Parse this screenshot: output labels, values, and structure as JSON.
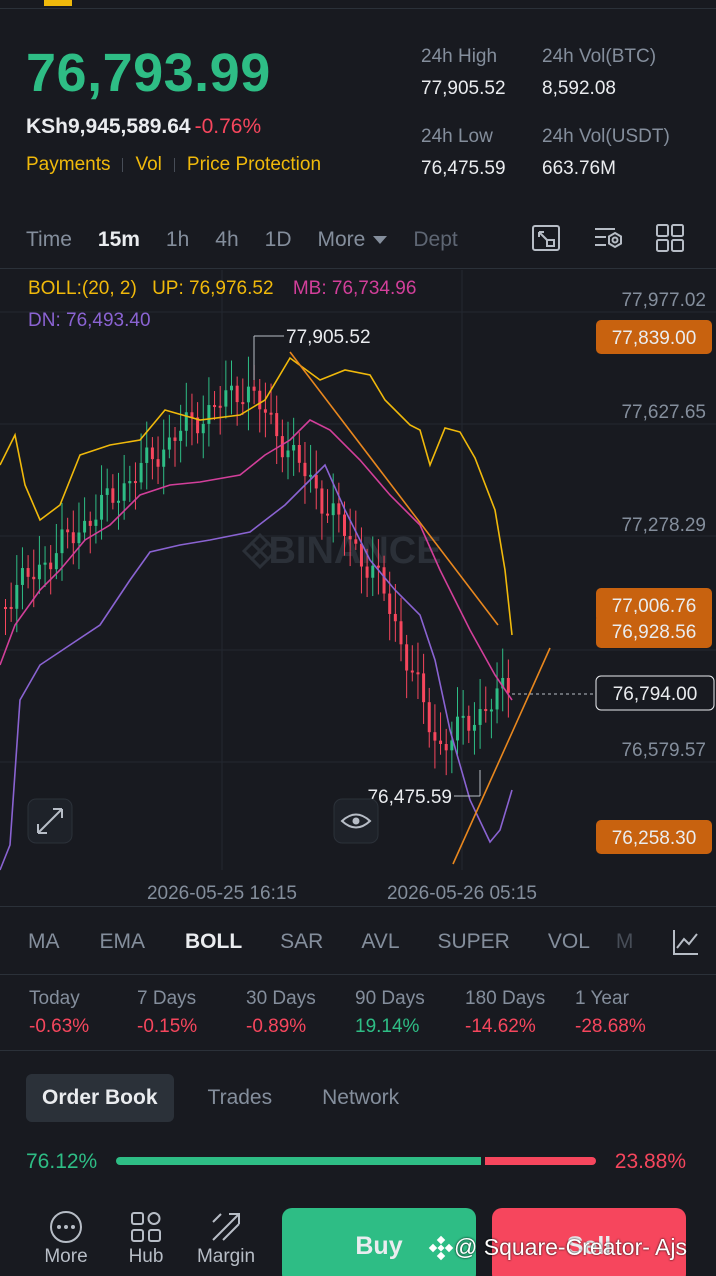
{
  "header": {
    "price": "76,793.99",
    "fiat_price": "KSh9,945,589.64",
    "change_pct": "-0.76%",
    "links": [
      "Payments",
      "Vol",
      "Price Protection"
    ]
  },
  "stats": {
    "high_label": "24h High",
    "high_value": "77,905.52",
    "vol_btc_label": "24h Vol(BTC)",
    "vol_btc_value": "8,592.08",
    "low_label": "24h Low",
    "low_value": "76,475.59",
    "vol_usdt_label": "24h Vol(USDT)",
    "vol_usdt_value": "663.76M"
  },
  "timeframes": {
    "items": [
      "Time",
      "15m",
      "1h",
      "4h",
      "1D"
    ],
    "active": "15m",
    "more_label": "More",
    "depth_label": "Dept"
  },
  "toolbar_icons": [
    "fullscreen-icon",
    "chart-settings-icon",
    "layout-grid-icon"
  ],
  "boll": {
    "label": "BOLL:(20, 2)",
    "up": "UP: 76,976.52",
    "mb": "MB: 76,734.96",
    "dn": "DN: 76,493.40"
  },
  "chart_data": {
    "type": "candlestick",
    "price_axis": [
      "77,977.02",
      "77,627.65",
      "77,278.29",
      "76,579.57"
    ],
    "price_tags": [
      {
        "value": "77,839.00",
        "color": "#c8620f"
      },
      {
        "value": "77,006.76",
        "color": "#c8620f"
      },
      {
        "value": "76,928.56",
        "color": "#c8620f"
      },
      {
        "value": "76,258.30",
        "color": "#c8620f"
      }
    ],
    "current_price_tag": "76,794.00",
    "high_annotation": "77,905.52",
    "low_annotation": "76,475.59",
    "time_axis": [
      "2026-05-25 16:15",
      "2026-05-26 05:15"
    ],
    "watermark": "BINANCE",
    "colors": {
      "up": "#2ebd85",
      "down": "#f6465d",
      "upper": "#f0b90b",
      "middle": "#d23f9a",
      "lower": "#8a63d2",
      "trendline": "#e8871e"
    }
  },
  "indicators": {
    "items": [
      "MA",
      "EMA",
      "BOLL",
      "SAR",
      "AVL",
      "SUPER",
      "VOL",
      "M"
    ],
    "active": "BOLL"
  },
  "performance": [
    {
      "label": "Today",
      "value": "-0.63%",
      "sign": "neg"
    },
    {
      "label": "7 Days",
      "value": "-0.15%",
      "sign": "neg"
    },
    {
      "label": "30 Days",
      "value": "-0.89%",
      "sign": "neg"
    },
    {
      "label": "90 Days",
      "value": "19.14%",
      "sign": "pos"
    },
    {
      "label": "180 Days",
      "value": "-14.62%",
      "sign": "neg"
    },
    {
      "label": "1 Year",
      "value": "-28.68%",
      "sign": "neg"
    }
  ],
  "orderbook": {
    "tabs": [
      "Order Book",
      "Trades",
      "Network"
    ],
    "active": "Order Book",
    "buy_ratio": "76.12%",
    "sell_ratio": "23.88%",
    "buy_fraction": 0.7612
  },
  "bottom_nav": {
    "items": [
      "More",
      "Hub",
      "Margin"
    ],
    "buy_label": "Buy",
    "sell_label": "Sell"
  },
  "watermark_bottom": "@ Square-Creator- Ajs"
}
